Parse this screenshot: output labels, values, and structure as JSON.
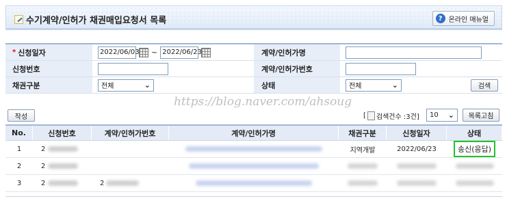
{
  "header": {
    "title": "수기계약/인허가 채권매입요청서 목록",
    "manual_button": "온라인 매뉴얼"
  },
  "form": {
    "required_mark": "*",
    "apply_date_label": "신청일자",
    "date_from": "2022/06/03",
    "date_separator": "~",
    "date_to": "2022/06/23",
    "contract_name_label": "계약/인허가명",
    "contract_name_value": "",
    "apply_no_label": "신청번호",
    "apply_no_value": "",
    "contract_no_label": "계약/인허가번호",
    "contract_no_value": "",
    "bond_type_label": "채권구분",
    "bond_type_selected": "전체",
    "status_label": "상태",
    "status_selected": "전체",
    "search_button": "검색"
  },
  "toolbar": {
    "write_button": "작성",
    "watermark": "https://blog.naver.com/ahsoug",
    "count_prefix": "[",
    "count_text": "검색건수 :3건]",
    "page_size": "10",
    "refresh_button": "목록고침"
  },
  "table": {
    "columns": [
      "No.",
      "신청번호",
      "계약/인허가번호",
      "계약/인허가명",
      "채권구분",
      "신청일자",
      "상태"
    ],
    "rows": [
      {
        "no": "1",
        "apply_no": "2",
        "contract_no": "",
        "bond_type": "지역개발",
        "apply_date": "2022/06/23",
        "status": "송신(응답)"
      },
      {
        "no": "2",
        "apply_no": "2",
        "contract_no": "",
        "bond_type": "",
        "apply_date": "",
        "status": ""
      },
      {
        "no": "3",
        "apply_no": "2",
        "contract_no": "2",
        "bond_type": "",
        "apply_date": "",
        "status": ""
      }
    ]
  },
  "colors": {
    "header_bg": "#e4ebf6",
    "highlight": "#21c42a",
    "required": "#e60012"
  }
}
